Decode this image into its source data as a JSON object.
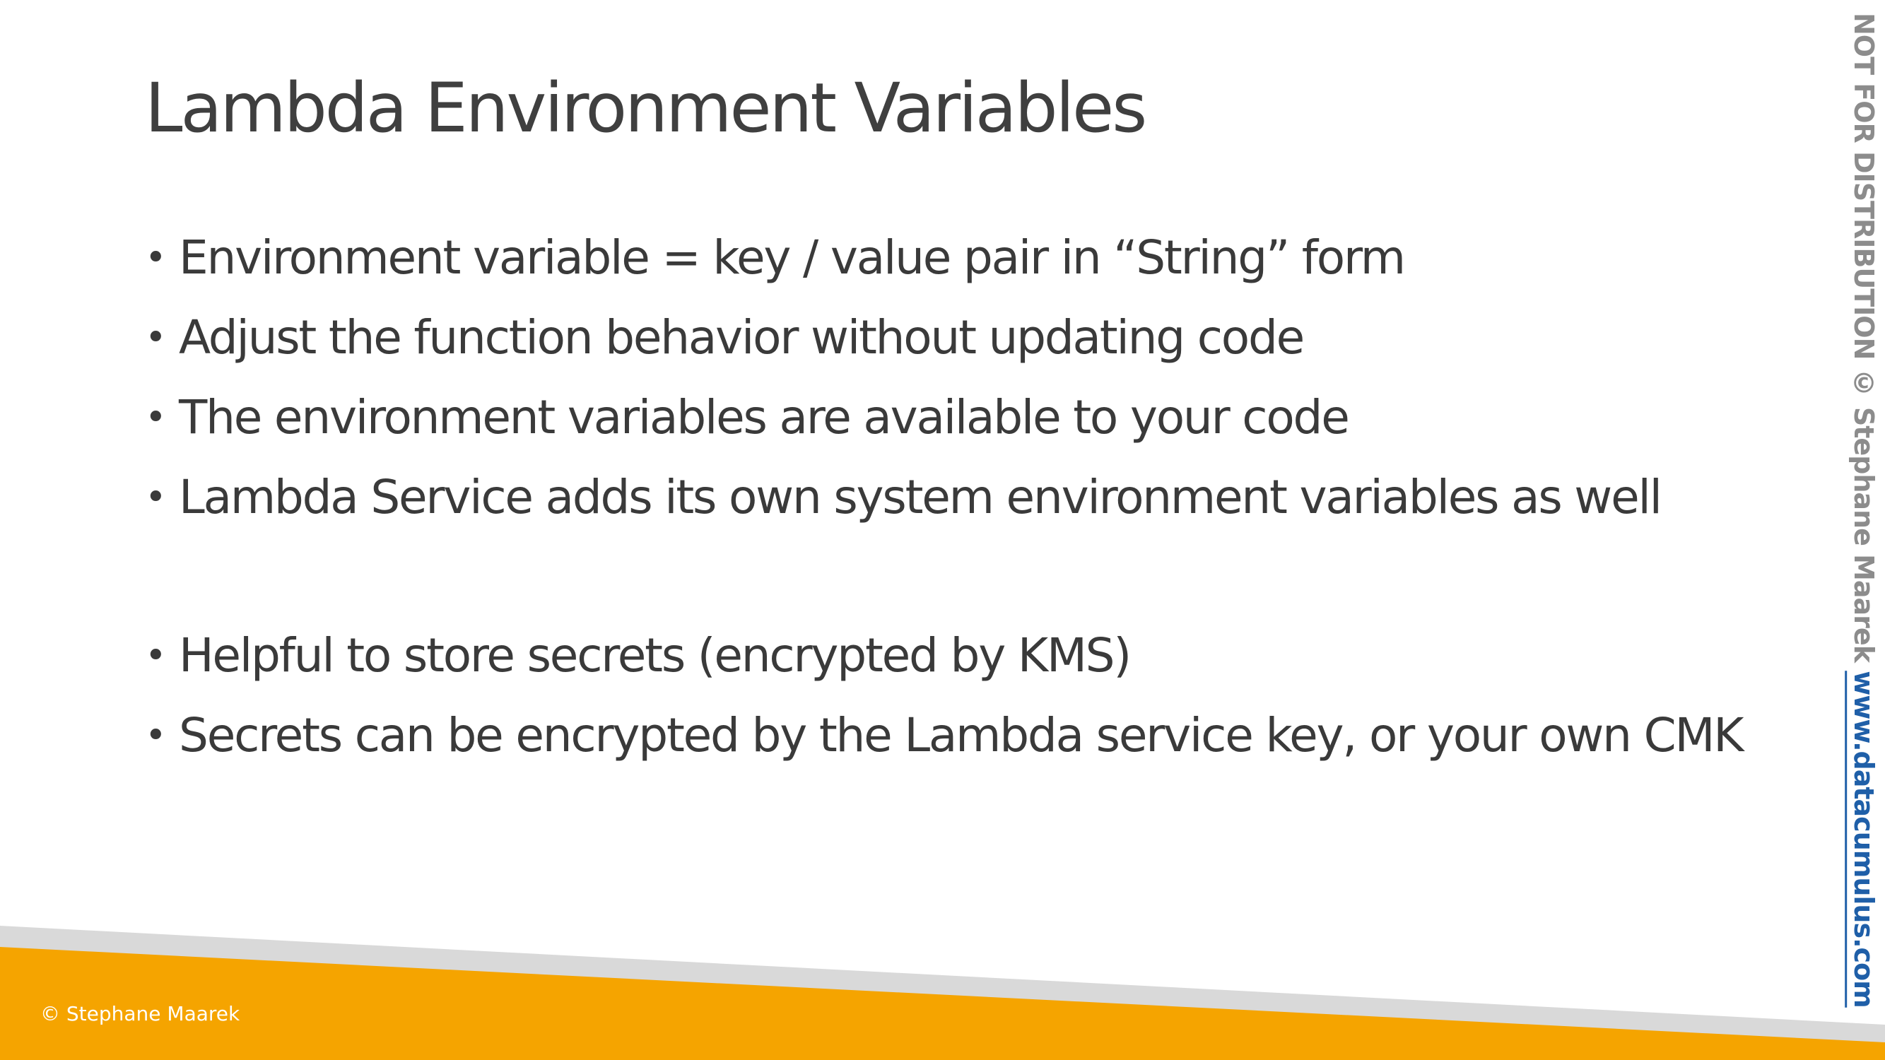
{
  "slide": {
    "title": "Lambda Environment Variables",
    "bullets": [
      "Environment variable = key / value pair in “String” form",
      "Adjust the function behavior without updating code",
      "The environment variables are available to your code",
      "Lambda Service adds its own system environment variables as well"
    ],
    "bullets_group2": [
      "Helpful to store secrets (encrypted by KMS)",
      "Secrets can be encrypted by the Lambda service key, or your own CMK"
    ],
    "bullet_glyph": "•"
  },
  "footer": {
    "copyright": "© Stephane Maarek",
    "band_color": "#f5a400",
    "stripe_color": "#d9d9d9"
  },
  "watermark": {
    "text": "NOT FOR DISTRIBUTION © Stephane Maarek ",
    "link": "www.datacumulus.com",
    "text_color": "#8c8c8c",
    "link_color": "#1f5fa8"
  }
}
